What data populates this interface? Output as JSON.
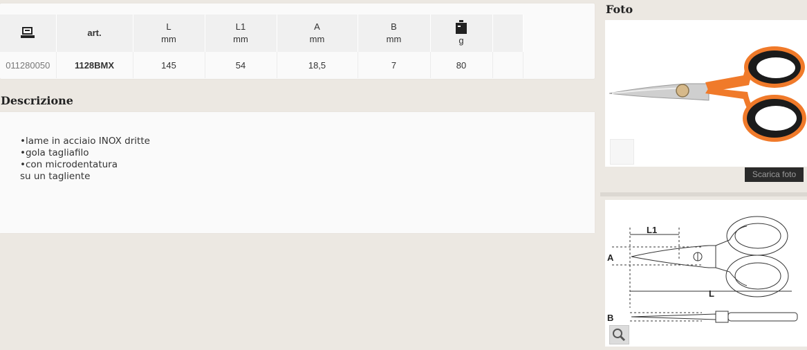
{
  "spec_table": {
    "headers": [
      {
        "icon": "item-code-icon",
        "label": "",
        "unit": ""
      },
      {
        "icon": "",
        "label": "art.",
        "unit": ""
      },
      {
        "icon": "",
        "label": "L",
        "unit": "mm"
      },
      {
        "icon": "",
        "label": "L1",
        "unit": "mm"
      },
      {
        "icon": "",
        "label": "A",
        "unit": "mm"
      },
      {
        "icon": "",
        "label": "B",
        "unit": "mm"
      },
      {
        "icon": "weight-icon",
        "label": "",
        "unit": "g"
      },
      {
        "icon": "",
        "label": "",
        "unit": ""
      }
    ],
    "row": {
      "code": "011280050",
      "art": "1128BMX",
      "L": "145",
      "L1": "54",
      "A": "18,5",
      "B": "7",
      "weight": "80",
      "extra": ""
    }
  },
  "description": {
    "title": "Descrizione",
    "lines": [
      "•lame in acciaio INOX dritte",
      "•gola tagliafilo",
      "•con microdentatura",
      "su un tagliente"
    ]
  },
  "photo": {
    "title": "Foto",
    "download_label": "Scarica foto",
    "colors": {
      "handle": "#f07a2a",
      "grip": "#1b1b1b",
      "blade": "#c9c9c9"
    }
  },
  "drawing": {
    "labels": {
      "L1": "L1",
      "A": "A",
      "L": "L",
      "B": "B"
    }
  }
}
